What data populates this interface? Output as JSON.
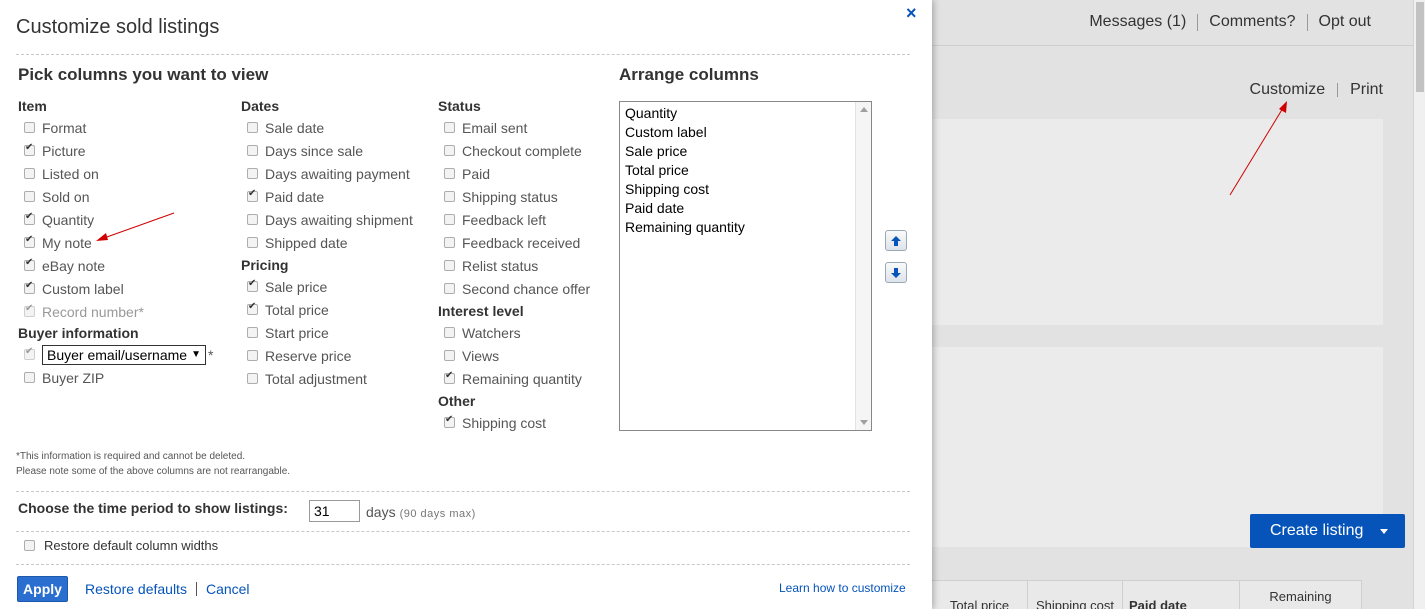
{
  "background": {
    "top_links": [
      "Messages (1)",
      "Comments?",
      "Opt out"
    ],
    "customize_link": "Customize",
    "print_link": "Print",
    "create_listing_label": "Create listing",
    "table_headers": [
      "Total price",
      "Shipping cost",
      "Paid date",
      "Remaining"
    ]
  },
  "modal": {
    "title": "Customize sold listings",
    "pick_heading": "Pick columns you want to view",
    "arrange_heading": "Arrange columns",
    "groups": {
      "item": {
        "label": "Item",
        "options": [
          {
            "label": "Format",
            "checked": false
          },
          {
            "label": "Picture",
            "checked": true
          },
          {
            "label": "Listed on",
            "checked": false
          },
          {
            "label": "Sold on",
            "checked": false
          },
          {
            "label": "Quantity",
            "checked": true
          },
          {
            "label": "My note",
            "checked": true
          },
          {
            "label": "eBay note",
            "checked": true
          },
          {
            "label": "Custom label",
            "checked": true
          },
          {
            "label": "Record number*",
            "checked": true,
            "disabled": true
          }
        ]
      },
      "buyer": {
        "label": "Buyer information",
        "select_value": "Buyer email/username",
        "required_mark": "*",
        "options": [
          {
            "label": "Buyer ZIP",
            "checked": false
          }
        ]
      },
      "dates": {
        "label": "Dates",
        "options": [
          {
            "label": "Sale date",
            "checked": false
          },
          {
            "label": "Days since sale",
            "checked": false
          },
          {
            "label": "Days awaiting payment",
            "checked": false
          },
          {
            "label": "Paid date",
            "checked": true
          },
          {
            "label": "Days awaiting shipment",
            "checked": false
          },
          {
            "label": "Shipped date",
            "checked": false
          }
        ]
      },
      "pricing": {
        "label": "Pricing",
        "options": [
          {
            "label": "Sale price",
            "checked": true
          },
          {
            "label": "Total price",
            "checked": true
          },
          {
            "label": "Start price",
            "checked": false
          },
          {
            "label": "Reserve price",
            "checked": false
          },
          {
            "label": "Total adjustment",
            "checked": false
          }
        ]
      },
      "status": {
        "label": "Status",
        "options": [
          {
            "label": "Email sent",
            "checked": false
          },
          {
            "label": "Checkout complete",
            "checked": false
          },
          {
            "label": "Paid",
            "checked": false
          },
          {
            "label": "Shipping status",
            "checked": false
          },
          {
            "label": "Feedback left",
            "checked": false
          },
          {
            "label": "Feedback received",
            "checked": false
          },
          {
            "label": "Relist status",
            "checked": false
          },
          {
            "label": "Second chance offer",
            "checked": false
          }
        ]
      },
      "interest": {
        "label": "Interest level",
        "options": [
          {
            "label": "Watchers",
            "checked": false
          },
          {
            "label": "Views",
            "checked": false
          },
          {
            "label": "Remaining quantity",
            "checked": true
          }
        ]
      },
      "other": {
        "label": "Other",
        "options": [
          {
            "label": "Shipping cost",
            "checked": true
          }
        ]
      }
    },
    "arrange_list": [
      "Quantity",
      "Custom label",
      "Sale price",
      "Total price",
      "Shipping cost",
      "Paid date",
      "Remaining quantity"
    ],
    "footnote_1": "*This information is required and cannot be deleted.",
    "footnote_2": "Please note some of the above columns are not rearrangable.",
    "period_label": "Choose the time period to show listings:",
    "period_value": "31",
    "days_label": "days",
    "days_max": "(90 days max)",
    "restore_widths_label": "Restore default column widths",
    "apply_label": "Apply",
    "restore_defaults_label": "Restore defaults",
    "cancel_label": "Cancel",
    "learn_label": "Learn how to customize",
    "close_glyph": "×"
  },
  "colors": {
    "accent": "#0654ba",
    "annotation_arrow": "#d00000"
  }
}
